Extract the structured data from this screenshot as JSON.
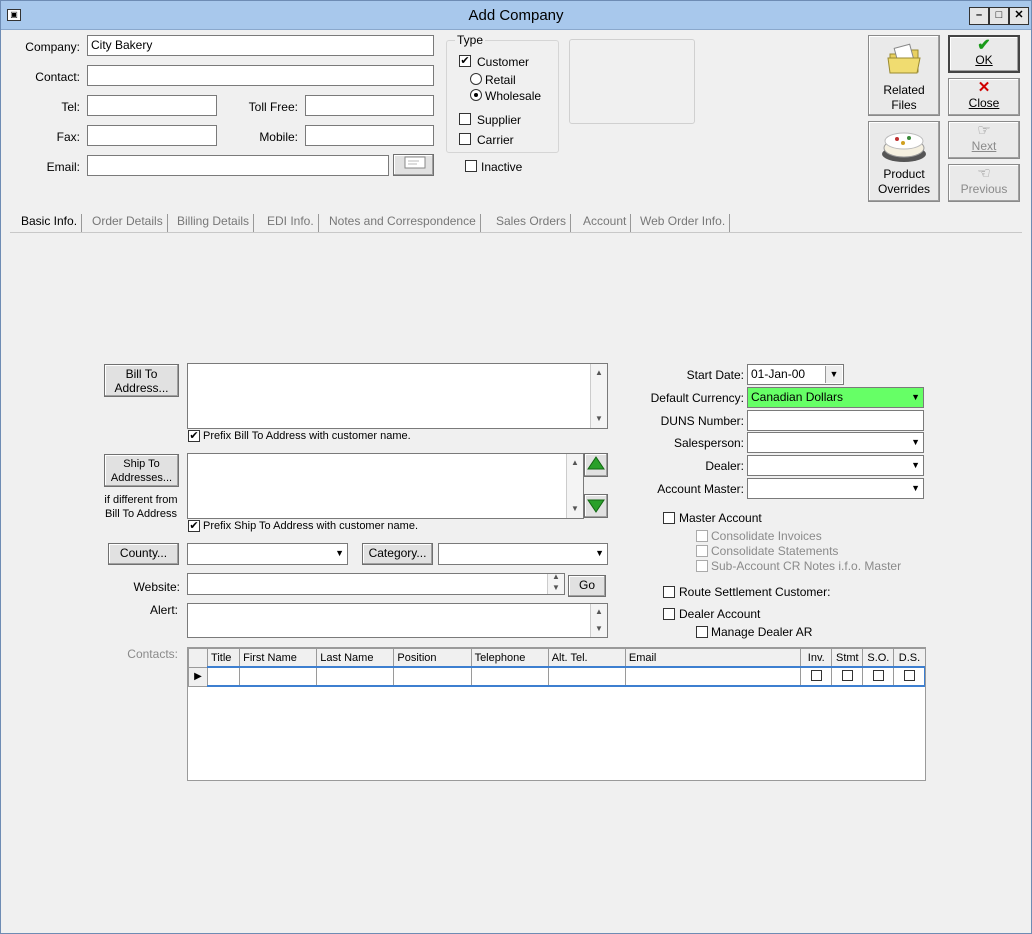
{
  "window": {
    "title": "Add Company"
  },
  "header": {
    "company_label": "Company:",
    "company_value": "City Bakery",
    "contact_label": "Contact:",
    "contact_value": "",
    "tel_label": "Tel:",
    "tollfree_label": "Toll Free:",
    "fax_label": "Fax:",
    "mobile_label": "Mobile:",
    "email_label": "Email:"
  },
  "type_group": {
    "title": "Type",
    "customer": "Customer",
    "retail": "Retail",
    "wholesale": "Wholesale",
    "supplier": "Supplier",
    "carrier": "Carrier",
    "inactive": "Inactive",
    "customer_checked": true,
    "wholesale_selected": true
  },
  "actions": {
    "ok": "OK",
    "close": "Close",
    "next": "Next",
    "previous": "Previous",
    "related_files_1": "Related",
    "related_files_2": "Files",
    "product_overrides_1": "Product",
    "product_overrides_2": "Overrides"
  },
  "tabs": [
    "Basic Info.",
    "Order Details",
    "Billing Details",
    "EDI Info.",
    "Notes and Correspondence",
    "Sales Orders",
    "Account",
    "Web Order Info."
  ],
  "basic": {
    "bill_to_1": "Bill To",
    "bill_to_2": "Address...",
    "prefix_bill": "Prefix Bill To Address with customer name.",
    "ship_to_1": "Ship To",
    "ship_to_2": "Addresses...",
    "if_diff_1": "if different from",
    "if_diff_2": "Bill To Address",
    "prefix_ship": "Prefix Ship To Address with customer name.",
    "county": "County...",
    "category": "Category...",
    "website": "Website:",
    "go": "Go",
    "alert": "Alert:",
    "contacts": "Contacts:",
    "start_date_label": "Start Date:",
    "start_date": "01-Jan-00",
    "currency_label": "Default Currency:",
    "currency": "Canadian Dollars",
    "duns_label": "DUNS Number:",
    "salesperson_label": "Salesperson:",
    "dealer_label": "Dealer:",
    "account_master_label": "Account Master:",
    "master_account": "Master Account",
    "consolidate_invoices": "Consolidate Invoices",
    "consolidate_statements": "Consolidate Statements",
    "subaccount_cr": "Sub-Account CR Notes i.f.o. Master",
    "route_settlement": "Route Settlement Customer:",
    "dealer_account": "Dealer Account",
    "manage_dealer_ar": "Manage Dealer AR"
  },
  "contacts_grid": {
    "columns": [
      "Title",
      "First Name",
      "Last Name",
      "Position",
      "Telephone",
      "Alt. Tel.",
      "Email",
      "Inv.",
      "Stmt",
      "S.O.",
      "D.S."
    ]
  },
  "colors": {
    "titlebar": "#a8c8ec",
    "currency_bg": "#66ff66",
    "ok_check": "#1a9a1a",
    "close_x": "#d00000"
  }
}
